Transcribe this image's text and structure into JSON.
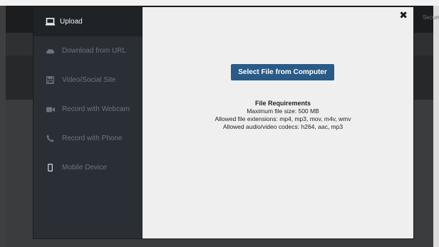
{
  "background": {
    "corner_text": "Secure"
  },
  "modal": {
    "close_label": "✖",
    "sidebar": {
      "items": [
        {
          "label": "Upload",
          "icon": "laptop-icon",
          "active": true
        },
        {
          "label": "Download from URL",
          "icon": "cloud-icon",
          "active": false
        },
        {
          "label": "Video/Social Site",
          "icon": "save-icon",
          "active": false
        },
        {
          "label": "Record with Webcam",
          "icon": "video-camera-icon",
          "active": false
        },
        {
          "label": "Record with Phone",
          "icon": "phone-icon",
          "active": false
        },
        {
          "label": "Mobile Device",
          "icon": "mobile-icon",
          "active": false
        }
      ]
    },
    "main": {
      "select_button_label": "Select File from Computer",
      "requirements": {
        "title": "File Requirements",
        "max_size": "Maximum file size: 500 MB",
        "extensions": "Allowed file extensions: mp4, mp3, mov, m4v, wmv",
        "codecs": "Allowed audio/video codecs: h264, aac, mp3"
      }
    }
  },
  "colors": {
    "sidebar_bg": "#2a2f35",
    "sidebar_active_bg": "#1f2327",
    "button_bg": "#2a5a86",
    "content_bg": "#efefef"
  }
}
